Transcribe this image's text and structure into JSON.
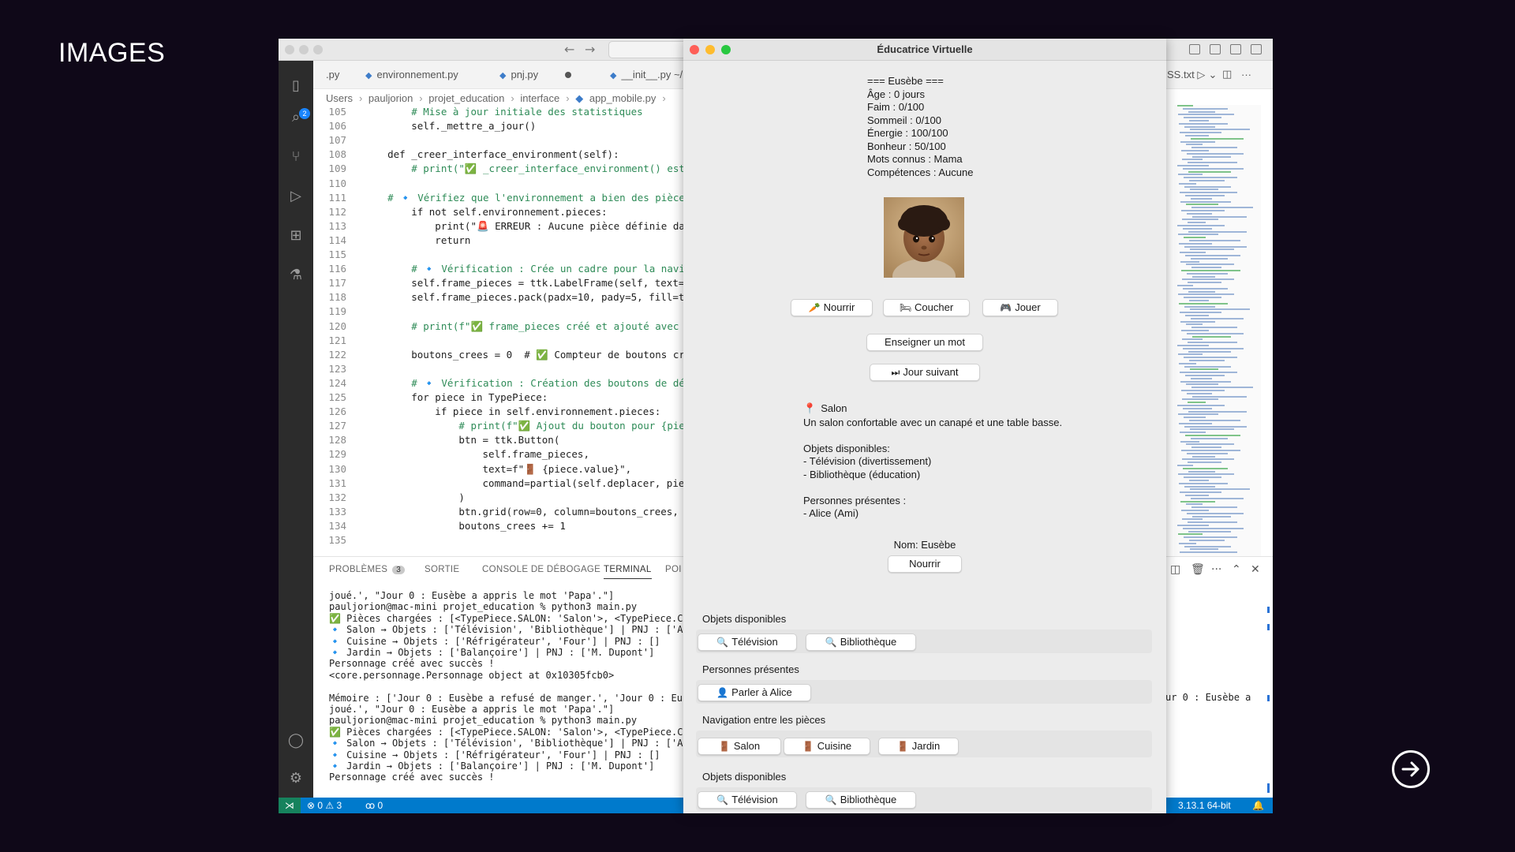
{
  "slide": {
    "title": "IMAGES"
  },
  "vscode": {
    "tabs": [
      {
        "label": ".py"
      },
      {
        "label": "environnement.py"
      },
      {
        "label": "pnj.py"
      },
      {
        "label": "__init__.py ~/..."
      }
    ],
    "tab_right": "SS.txt",
    "breadcrumb": [
      "Users",
      "pauljorion",
      "projet_education",
      "interface",
      "app_mobile.py"
    ],
    "code_lines": [
      {
        "n": "105",
        "t": "        # Mise à jour initiale des statistiques"
      },
      {
        "n": "106",
        "t": "        self._mettre_a_jour()"
      },
      {
        "n": "107",
        "t": ""
      },
      {
        "n": "108",
        "t": "    def _creer_interface_environment(self):"
      },
      {
        "n": "109",
        "t": "        # print(\"✅ _creer_interface_environment() est"
      },
      {
        "n": "110",
        "t": ""
      },
      {
        "n": "111",
        "t": "    # 🔹 Vérifiez que l'environnement a bien des pièce"
      },
      {
        "n": "112",
        "t": "        if not self.environnement.pieces:"
      },
      {
        "n": "113",
        "t": "            print(\"🚨 ERREUR : Aucune pièce définie da"
      },
      {
        "n": "114",
        "t": "            return"
      },
      {
        "n": "115",
        "t": ""
      },
      {
        "n": "116",
        "t": "        # 🔹 Vérification : Crée un cadre pour la navi"
      },
      {
        "n": "117",
        "t": "        self.frame_pieces = ttk.LabelFrame(self, text="
      },
      {
        "n": "118",
        "t": "        self.frame_pieces.pack(padx=10, pady=5, fill=t"
      },
      {
        "n": "119",
        "t": ""
      },
      {
        "n": "120",
        "t": "        # print(f\"✅ frame_pieces créé et ajouté avec"
      },
      {
        "n": "121",
        "t": ""
      },
      {
        "n": "122",
        "t": "        boutons_crees = 0  # ✅ Compteur de boutons cr"
      },
      {
        "n": "123",
        "t": ""
      },
      {
        "n": "124",
        "t": "        # 🔹 Vérification : Création des boutons de dé"
      },
      {
        "n": "125",
        "t": "        for piece in TypePiece:"
      },
      {
        "n": "126",
        "t": "            if piece in self.environnement.pieces:"
      },
      {
        "n": "127",
        "t": "                # print(f\"✅ Ajout du bouton pour {pie"
      },
      {
        "n": "128",
        "t": "                btn = ttk.Button("
      },
      {
        "n": "129",
        "t": "                    self.frame_pieces,"
      },
      {
        "n": "130",
        "t": "                    text=f\"🚪 {piece.value}\","
      },
      {
        "n": "131",
        "t": "                    command=partial(self.deplacer, pie"
      },
      {
        "n": "132",
        "t": "                )"
      },
      {
        "n": "133",
        "t": "                btn.grid(row=0, column=boutons_crees,"
      },
      {
        "n": "134",
        "t": "                boutons_crees += 1"
      },
      {
        "n": "135",
        "t": ""
      }
    ],
    "panel_tabs": {
      "problems": "PROBLÈMES",
      "problems_count": "3",
      "output": "SORTIE",
      "debug": "CONSOLE DE DÉBOGAGE",
      "terminal": "TERMINAL",
      "ports": "POI"
    },
    "terminal_lines": [
      "joué.', \"Jour 0 : Eusèbe a appris le mot 'Papa'.\"]",
      "pauljorion@mac-mini projet_education % python3 main.py",
      "✅ Pièces chargées : [<TypePiece.SALON: 'Salon'>, <TypePiece.C",
      "🔹 Salon → Objets : ['Télévision', 'Bibliothèque'] | PNJ : ['A",
      "🔹 Cuisine → Objets : ['Réfrigérateur', 'Four'] | PNJ : []",
      "🔹 Jardin → Objets : ['Balançoire'] | PNJ : ['M. Dupont']",
      "Personnage créé avec succès !",
      "<core.personnage.Personnage object at 0x10305fcb0>",
      "",
      "Mémoire : ['Jour 0 : Eusèbe a refusé de manger.', 'Jour 0 : Eu",
      "joué.', \"Jour 0 : Eusèbe a appris le mot 'Papa'.\"]",
      "pauljorion@mac-mini projet_education % python3 main.py",
      "✅ Pièces chargées : [<TypePiece.SALON: 'Salon'>, <TypePiece.C",
      "🔹 Salon → Objets : ['Télévision', 'Bibliothèque'] | PNJ : ['A",
      "🔹 Cuisine → Objets : ['Réfrigérateur', 'Four'] | PNJ : []",
      "🔹 Jardin → Objets : ['Balançoire'] | PNJ : ['M. Dupont']",
      "Personnage créé avec succès !"
    ],
    "terminal_right": "ur 0 : Eusèbe a",
    "status": {
      "errors": "⊗ 0 ⚠ 3",
      "ports": "ꝏ 0",
      "python": "3.13.1 64-bit"
    }
  },
  "app": {
    "title": "Éducatrice Virtuelle",
    "stats": [
      "=== Eusèbe ===",
      "Âge : 0 jours",
      "Faim : 0/100",
      "Sommeil : 0/100",
      "Énergie : 100/100",
      "Bonheur : 50/100",
      "Mots connus : Mama",
      "Compétences : Aucune"
    ],
    "buttons": {
      "nourrir": "Nourrir",
      "coucher": "Coucher",
      "jouer": "Jouer",
      "enseigner": "Enseigner un mot",
      "jour_suivant": "Jour suivant"
    },
    "room": {
      "name": "Salon",
      "lines": [
        "Un salon confortable avec un canapé et une table basse.",
        "",
        "Objets disponibles:",
        "- Télévision (divertissement)",
        "- Bibliothèque (éducation)",
        "",
        "Personnes présentes :",
        "- Alice (Ami)"
      ]
    },
    "nom_label": "Nom: Eusèbe",
    "nom_button": "Nourrir",
    "sections": {
      "objets": "Objets disponibles",
      "television": "Télévision",
      "bibliotheque": "Bibliothèque",
      "personnes": "Personnes présentes",
      "parler": "Parler à Alice",
      "navigation": "Navigation entre les pièces",
      "salon": "Salon",
      "cuisine": "Cuisine",
      "jardin": "Jardin",
      "objets2": "Objets disponibles",
      "television2": "Télévision",
      "bibliotheque2": "Bibliothèque"
    }
  }
}
